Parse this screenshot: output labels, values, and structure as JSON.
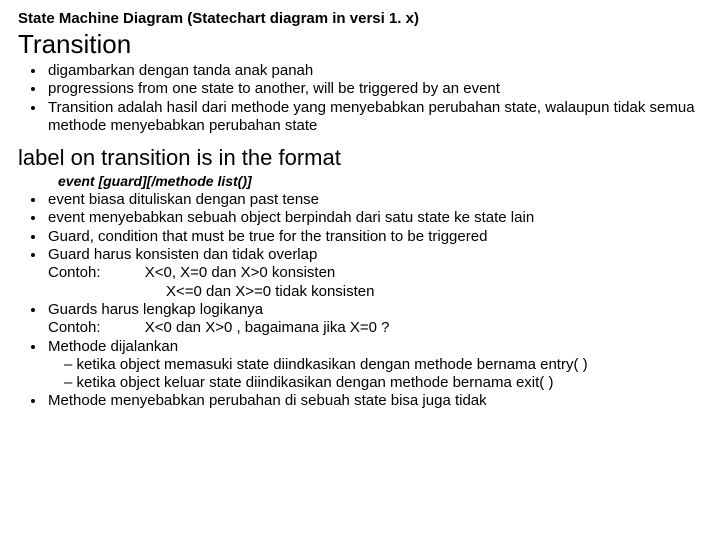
{
  "header": {
    "super": "State Machine Diagram (Statechart diagram in versi 1. x)",
    "title": "Transition"
  },
  "sec1": {
    "b1": "digambarkan dengan tanda anak panah",
    "b2": "progressions from one state to another, will be triggered by an event",
    "b3": "Transition adalah hasil dari methode yang menyebabkan perubahan state, walaupun tidak semua methode menyebabkan perubahan state"
  },
  "sec2": {
    "title": "label on transition is in the format",
    "sub": "event [guard][/methode list()]",
    "b1": "event biasa dituliskan dengan past tense",
    "b2": "event menyebabkan sebuah object berpindah dari satu state ke state lain",
    "b3": "Guard, condition that must be true for the transition to be triggered",
    "b4_t": "Guard harus konsisten dan tidak overlap",
    "b4_c_label": "Contoh:",
    "b4_c1": "X<0, X=0 dan X>0 konsisten",
    "b4_c2": "X<=0 dan X>=0 tidak konsisten",
    "b5_t": "Guards harus lengkap logikanya",
    "b5_c_label": "Contoh:",
    "b5_c1": "X<0 dan X>0 , bagaimana jika X=0 ?",
    "b6_t": "Methode dijalankan",
    "b6_d1": "ketika object memasuki state diindkasikan dengan methode bernama entry( )",
    "b6_d2": "ketika object keluar state diindikasikan dengan methode bernama exit( )",
    "b7": "Methode menyebabkan perubahan di sebuah state bisa juga tidak"
  }
}
